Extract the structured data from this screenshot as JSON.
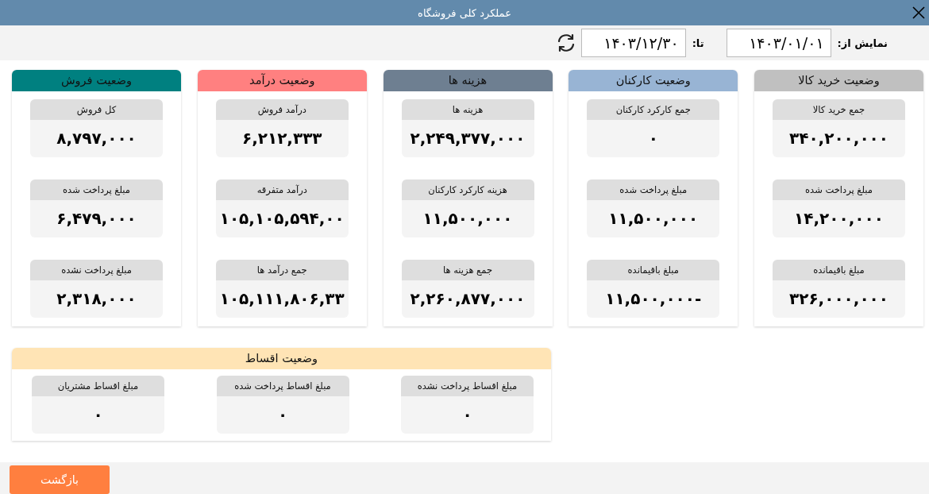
{
  "window": {
    "title": "عملکرد کلی فروشگاه"
  },
  "filter": {
    "from_label": "نمایش از:",
    "from_value": "۱۴۰۳/۰۱/۰۱",
    "to_label": "تا:",
    "to_value": "۱۴۰۳/۱۲/۳۰"
  },
  "panels": [
    {
      "title": "وضعیت خرید کالا",
      "color": "#c0c0c0",
      "cards": [
        {
          "label": "جمع خرید کالا",
          "value": "۳۴۰,۲۰۰,۰۰۰"
        },
        {
          "label": "مبلغ پرداخت شده",
          "value": "۱۴,۲۰۰,۰۰۰"
        },
        {
          "label": "مبلغ باقیمانده",
          "value": "۳۲۶,۰۰۰,۰۰۰"
        }
      ]
    },
    {
      "title": "وضعیت کارکنان",
      "color": "#98b4d4",
      "cards": [
        {
          "label": "جمع کارکرد کارکنان",
          "value": "۰"
        },
        {
          "label": "مبلغ پرداخت شده",
          "value": "۱۱,۵۰۰,۰۰۰"
        },
        {
          "label": "مبلغ باقیمانده",
          "value": "۱۱,۵۰۰,۰۰۰-"
        }
      ]
    },
    {
      "title": "هزینه ها",
      "color": "#6e7f91",
      "cards": [
        {
          "label": "هزینه ها",
          "value": "۲,۲۴۹,۳۷۷,۰۰۰"
        },
        {
          "label": "هزینه کارکرد کارکنان",
          "value": "۱۱,۵۰۰,۰۰۰"
        },
        {
          "label": "جمع هزینه ها",
          "value": "۲,۲۶۰,۸۷۷,۰۰۰"
        }
      ]
    },
    {
      "title": "وضعیت درآمد",
      "color": "#ff8080",
      "cards": [
        {
          "label": "درآمد فروش",
          "value": "۶,۲۱۲,۳۳۳"
        },
        {
          "label": "درآمد متفرقه",
          "value": "۱۰۵,۱۰۵,۵۹۴,۰۰"
        },
        {
          "label": "جمع درآمد ها",
          "value": "۱۰۵,۱۱۱,۸۰۶,۳۳"
        }
      ]
    },
    {
      "title": "وضعیت فروش",
      "color": "#008080",
      "cards": [
        {
          "label": "کل فروش",
          "value": "۸,۷۹۷,۰۰۰"
        },
        {
          "label": "مبلغ پرداخت شده",
          "value": "۶,۴۷۹,۰۰۰"
        },
        {
          "label": "مبلغ پرداخت نشده",
          "value": "۲,۳۱۸,۰۰۰"
        }
      ]
    }
  ],
  "installments": {
    "title": "وضعیت اقساط",
    "color": "#ffe4b5",
    "cards": [
      {
        "label": "مبلغ اقساط پرداخت نشده",
        "value": "۰"
      },
      {
        "label": "مبلغ اقساط پرداخت شده",
        "value": "۰"
      },
      {
        "label": "مبلغ اقساط مشتریان",
        "value": "۰"
      }
    ]
  },
  "footer": {
    "back_button": "بازگشت"
  }
}
